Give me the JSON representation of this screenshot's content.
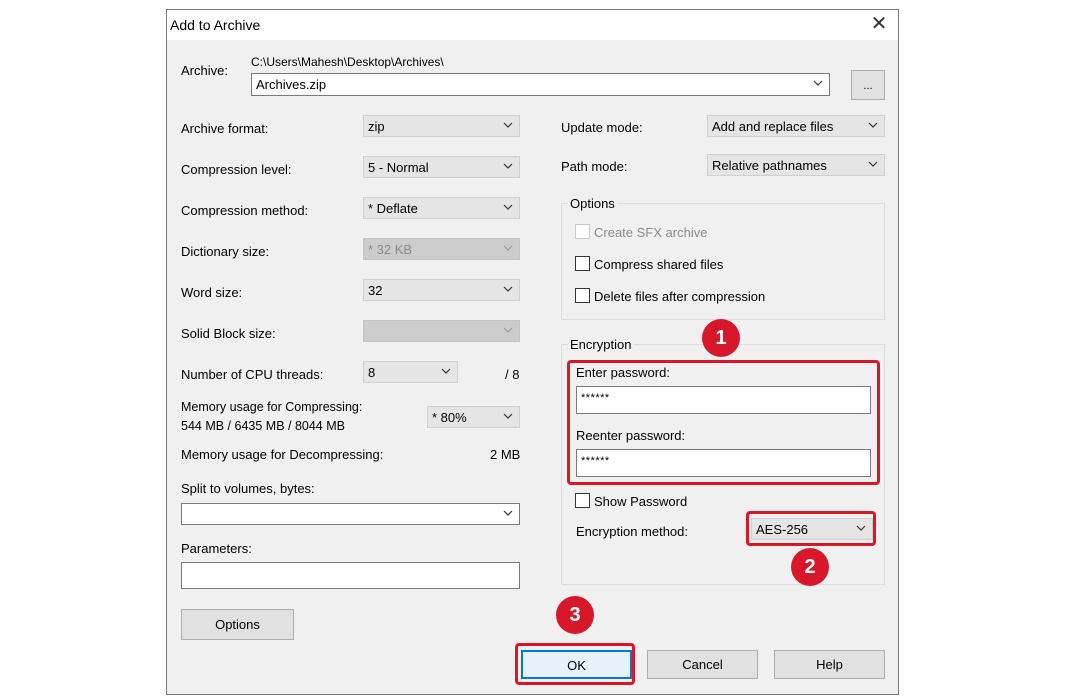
{
  "dialog": {
    "title": "Add to Archive",
    "archive_label": "Archive:",
    "archive_path": "C:\\Users\\Mahesh\\Desktop\\Archives\\",
    "archive_name": "Archives.zip",
    "browse_label": "..."
  },
  "left": {
    "archive_format_label": "Archive format:",
    "archive_format_value": "zip",
    "compression_level_label": "Compression level:",
    "compression_level_value": "5 - Normal",
    "compression_method_label": "Compression method:",
    "compression_method_value": "* Deflate",
    "dictionary_size_label": "Dictionary size:",
    "dictionary_size_value": "* 32 KB",
    "word_size_label": "Word size:",
    "word_size_value": "32",
    "solid_block_label": "Solid Block size:",
    "solid_block_value": "",
    "cpu_threads_label": "Number of CPU threads:",
    "cpu_threads_value": "8",
    "cpu_threads_max": "/ 8",
    "mem_compress_label": "Memory usage for Compressing:",
    "mem_compress_detail": "544 MB / 6435 MB / 8044 MB",
    "mem_compress_value": "* 80%",
    "mem_decompress_label": "Memory usage for Decompressing:",
    "mem_decompress_value": "2 MB",
    "split_label": "Split to volumes, bytes:",
    "split_value": "",
    "parameters_label": "Parameters:",
    "parameters_value": "",
    "options_button": "Options"
  },
  "right": {
    "update_mode_label": "Update mode:",
    "update_mode_value": "Add and replace files",
    "path_mode_label": "Path mode:",
    "path_mode_value": "Relative pathnames",
    "options_group_label": "Options",
    "create_sfx_label": "Create SFX archive",
    "compress_shared_label": "Compress shared files",
    "delete_after_label": "Delete files after compression",
    "encryption_group_label": "Encryption",
    "enter_password_label": "Enter password:",
    "enter_password_value": "******",
    "reenter_password_label": "Reenter password:",
    "reenter_password_value": "******",
    "show_password_label": "Show Password",
    "encryption_method_label": "Encryption method:",
    "encryption_method_value": "AES-256"
  },
  "buttons": {
    "ok": "OK",
    "cancel": "Cancel",
    "help": "Help"
  },
  "annotations": {
    "badge1": "1",
    "badge2": "2",
    "badge3": "3",
    "highlight_color": "#d9172a"
  },
  "icons": {
    "close": "close-icon",
    "dropdown": "chevron-down-icon"
  }
}
